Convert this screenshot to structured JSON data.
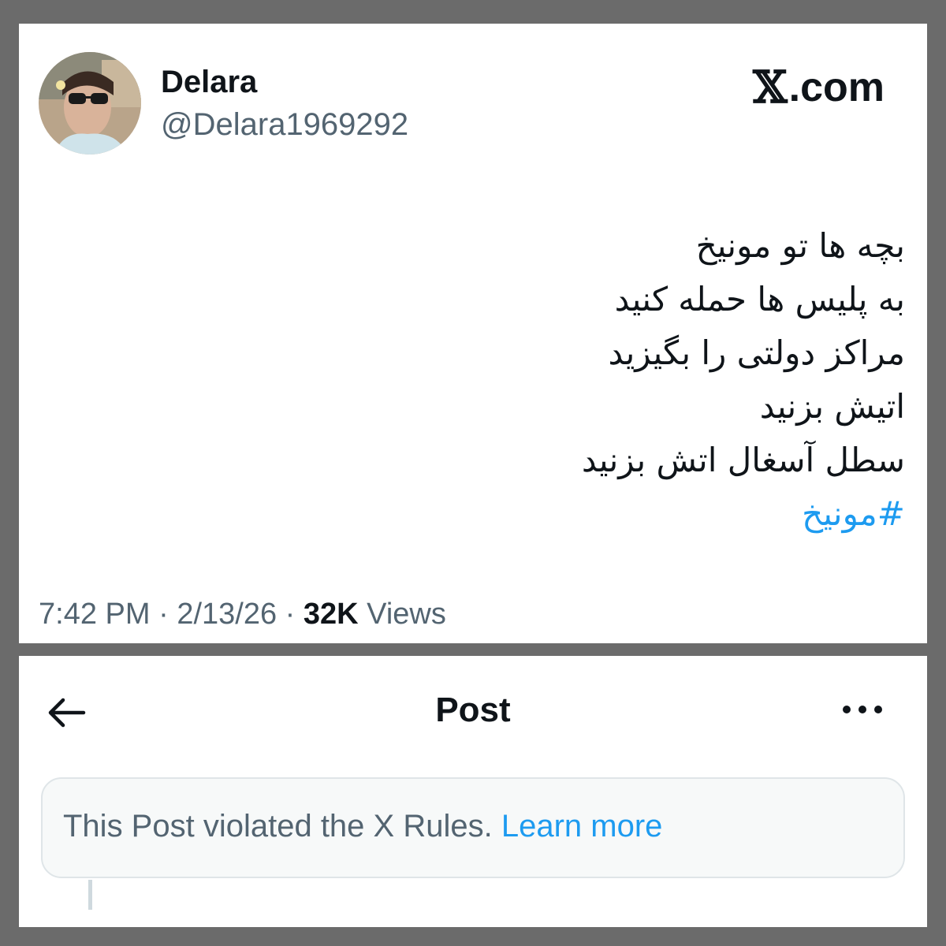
{
  "tweet": {
    "display_name": "Delara",
    "handle": "@Delara1969292",
    "brand": {
      "x_glyph": "𝕏",
      "suffix": ".com"
    },
    "lines": [
      "بچه ها تو مونیخ",
      "به پلیس ها حمله کنید",
      "مراکز دولتی را بگیزید",
      "اتیش بزنید",
      "سطل آسغال اتش بزنید"
    ],
    "hashtag": "#مونیخ",
    "time": "7:42 PM",
    "date": "2/13/26",
    "views_count": "32K",
    "views_label": "Views",
    "separator": "·"
  },
  "post_view": {
    "title": "Post",
    "notice_text": "This Post violated the X Rules.",
    "learn_more": "Learn more"
  },
  "colors": {
    "accent": "#1d9bf0",
    "text_primary": "#0f1419",
    "text_secondary": "#536471",
    "frame": "#6b6b6b"
  },
  "icons": {
    "back": "back-arrow-icon",
    "more": "more-horizontal-icon"
  }
}
